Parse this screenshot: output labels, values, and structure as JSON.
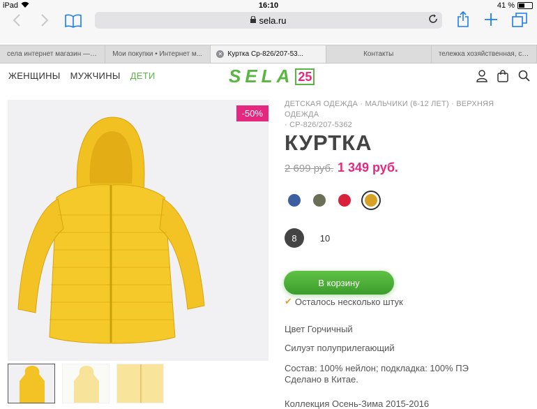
{
  "status": {
    "device": "iPad",
    "time": "16:10",
    "battery": "41 %"
  },
  "browser": {
    "url": "sela.ru",
    "tabs": [
      {
        "label": "села интернет магазин — Я..."
      },
      {
        "label": "Мои покупки • Интернет м..."
      },
      {
        "label": "Куртка Ср-826/207-53..."
      },
      {
        "label": "Контакты"
      },
      {
        "label": "тележка хозяйственная, ск..."
      }
    ]
  },
  "site": {
    "nav": [
      "ЖЕНЩИНЫ",
      "МУЖЧИНЫ",
      "ДЕТИ"
    ],
    "logo_word": "SELA",
    "logo_num": "25"
  },
  "product": {
    "breadcrumb": [
      "ДЕТСКАЯ ОДЕЖДА",
      "МАЛЬЧИКИ (6-12 ЛЕТ)",
      "ВЕРХНЯЯ ОДЕЖДА",
      "СР-826/207-5362"
    ],
    "title": "КУРТКА",
    "old_price": "2 699 руб.",
    "new_price": "1 349 руб.",
    "sale_badge": "-50%",
    "colors": [
      "#3b5fa0",
      "#6b6f55",
      "#d9213a",
      "#d7a125"
    ],
    "selected_color_index": 3,
    "sizes": [
      "8",
      "10"
    ],
    "selected_size": "8",
    "cart_button": "В корзину",
    "stock_text": "Осталось несколько штук",
    "color_line": "Цвет Горчичный",
    "silhouette_line": "Силуэт полуприлегающий",
    "composition_line": "Состав: 100% нейлон; подкладка: 100% ПЭ",
    "made_in_line": "Сделано в Китае.",
    "collection_line": "Коллекция Осень-Зима 2015-2016"
  }
}
